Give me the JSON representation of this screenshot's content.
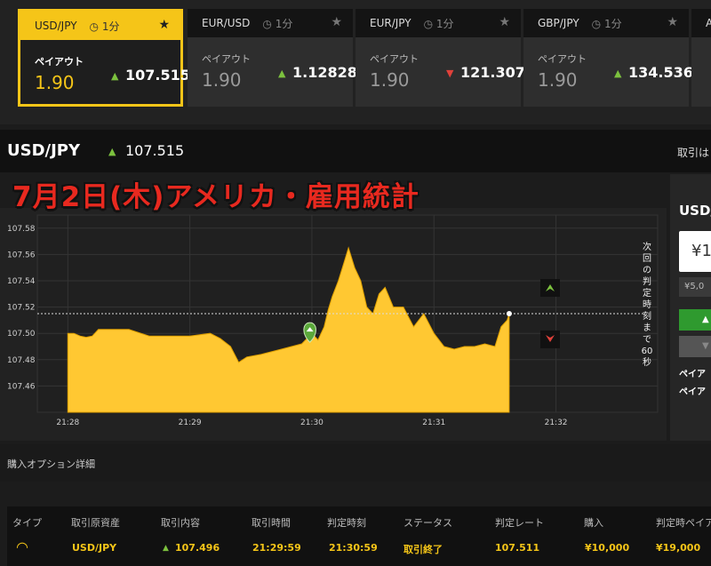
{
  "tabs": [
    {
      "pair": "USD/JPY",
      "duration": "1分",
      "payout_label": "ペイアウト",
      "payout": "1.90",
      "rate": "107.515",
      "direction": "up"
    },
    {
      "pair": "EUR/USD",
      "duration": "1分",
      "payout_label": "ペイアウト",
      "payout": "1.90",
      "rate": "1.12828",
      "direction": "up"
    },
    {
      "pair": "EUR/JPY",
      "duration": "1分",
      "payout_label": "ペイアウト",
      "payout": "1.90",
      "rate": "121.307",
      "direction": "down"
    },
    {
      "pair": "GBP/JPY",
      "duration": "1分",
      "payout_label": "ペイアウト",
      "payout": "1.90",
      "rate": "134.536",
      "direction": "up"
    },
    {
      "pair": "A"
    }
  ],
  "header": {
    "pair": "USD/JPY",
    "rate": "107.515",
    "side_note": "取引は"
  },
  "banner": "7月2日(木)アメリカ・雇用統計",
  "countdown": "次回の判定時刻まで60秒",
  "colors": {
    "accent": "#f5c518",
    "up": "#7cc13e",
    "down": "#e0413a",
    "area": "#ffc832"
  },
  "chart_data": {
    "type": "area",
    "series": [
      {
        "values": [
          [
            "21:28:00",
            107.5
          ],
          [
            "21:28:03",
            107.5
          ],
          [
            "21:28:06",
            107.498
          ],
          [
            "21:28:09",
            107.497
          ],
          [
            "21:28:12",
            107.498
          ],
          [
            "21:28:15",
            107.503
          ],
          [
            "21:28:20",
            107.503
          ],
          [
            "21:28:30",
            107.503
          ],
          [
            "21:28:40",
            107.498
          ],
          [
            "21:28:50",
            107.498
          ],
          [
            "21:29:00",
            107.498
          ],
          [
            "21:29:10",
            107.5
          ],
          [
            "21:29:15",
            107.496
          ],
          [
            "21:29:20",
            107.49
          ],
          [
            "21:29:24",
            107.478
          ],
          [
            "21:29:28",
            107.482
          ],
          [
            "21:29:35",
            107.484
          ],
          [
            "21:29:45",
            107.488
          ],
          [
            "21:29:55",
            107.492
          ],
          [
            "21:30:00",
            107.5
          ],
          [
            "21:30:03",
            107.495
          ],
          [
            "21:30:06",
            107.505
          ],
          [
            "21:30:08",
            107.518
          ],
          [
            "21:30:10",
            107.528
          ],
          [
            "21:30:13",
            107.54
          ],
          [
            "21:30:16",
            107.555
          ],
          [
            "21:30:18",
            107.565
          ],
          [
            "21:30:21",
            107.55
          ],
          [
            "21:30:24",
            107.54
          ],
          [
            "21:30:27",
            107.52
          ],
          [
            "21:30:30",
            107.515
          ],
          [
            "21:30:33",
            107.53
          ],
          [
            "21:30:36",
            107.535
          ],
          [
            "21:30:40",
            107.52
          ],
          [
            "21:30:45",
            107.52
          ],
          [
            "21:30:50",
            107.505
          ],
          [
            "21:30:55",
            107.515
          ],
          [
            "21:31:00",
            107.5
          ],
          [
            "21:31:05",
            107.49
          ],
          [
            "21:31:10",
            107.488
          ],
          [
            "21:31:15",
            107.49
          ],
          [
            "21:31:20",
            107.49
          ],
          [
            "21:31:25",
            107.492
          ],
          [
            "21:31:30",
            107.49
          ],
          [
            "21:31:33",
            107.505
          ],
          [
            "21:31:36",
            107.51
          ],
          [
            "21:31:37",
            107.515
          ]
        ]
      }
    ],
    "ylim": [
      107.44,
      107.59
    ],
    "yticks": [
      "107.58",
      "107.56",
      "107.54",
      "107.52",
      "107.50",
      "107.48",
      "107.46"
    ],
    "xticks": [
      "21:28",
      "21:29",
      "21:30",
      "21:31",
      "21:32"
    ],
    "xlim": [
      "21:27:45",
      "21:32:50"
    ],
    "reference_line": 107.515,
    "entry_marker": [
      "21:29:59",
      107.496
    ],
    "grid": true
  },
  "right_panel": {
    "pair": "USD/",
    "amount": "¥1",
    "preset": "¥5,0",
    "payout_1": "ペイア",
    "payout_2": "ペイア"
  },
  "details": {
    "title": "購入オプション詳細",
    "headers": [
      "タイプ",
      "取引原資産",
      "取引内容",
      "取引時間",
      "判定時刻",
      "ステータス",
      "判定レート",
      "購入",
      "判定時ペイア"
    ],
    "row": {
      "asset": "USD/JPY",
      "entry_rate": "107.496",
      "trade_time": "21:29:59",
      "judge_time": "21:30:59",
      "status": "取引終了",
      "judge_rate": "107.511",
      "purchase": "¥10,000",
      "payout": "¥19,000"
    }
  }
}
